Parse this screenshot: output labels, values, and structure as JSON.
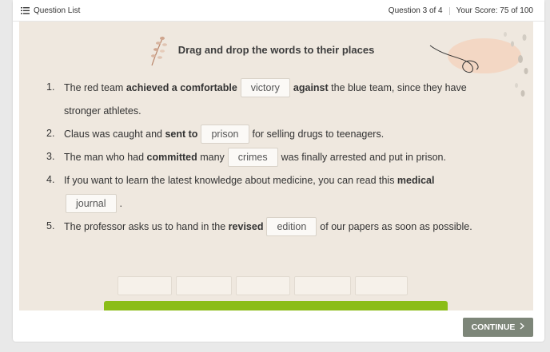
{
  "header": {
    "question_list_label": "Question List",
    "question_progress": "Question 3 of 4",
    "score": "Your Score: 75 of 100"
  },
  "exercise": {
    "instruction": "Drag and drop the words to their places",
    "items": [
      {
        "number": "1.",
        "line1_pre": "The red team ",
        "line1_bold": "achieved a comfortable",
        "answer": "victory",
        "line1_post_bold": "against",
        "line1_post": " the blue team, since they have",
        "line2": "stronger athletes."
      },
      {
        "number": "2.",
        "pre": "Claus was caught and ",
        "bold": "sent to",
        "answer": "prison",
        "post": "for selling drugs to teenagers."
      },
      {
        "number": "3.",
        "pre": "The man who had ",
        "bold": "committed",
        "mid": " many",
        "answer": "crimes",
        "post": "was finally arrested and put in prison."
      },
      {
        "number": "4.",
        "pre": "If you want to learn the latest knowledge about medicine, you can read this ",
        "bold": "medical",
        "answer": "journal",
        "post": "."
      },
      {
        "number": "5.",
        "pre": "The professor asks us to hand in the ",
        "bold": "revised",
        "answer": "edition",
        "post": "of our papers as soon as possible."
      }
    ]
  },
  "footer": {
    "continue_label": "CONTINUE"
  },
  "icons": {
    "list": "list-icon",
    "chevron": "chevron-right-icon",
    "sprig": "sprig-decoration",
    "swirl": "swirl-decoration"
  },
  "colors": {
    "stage_bg": "#efe8df",
    "continue_bg": "#7d8679",
    "green_bar": "#8bbd18"
  }
}
